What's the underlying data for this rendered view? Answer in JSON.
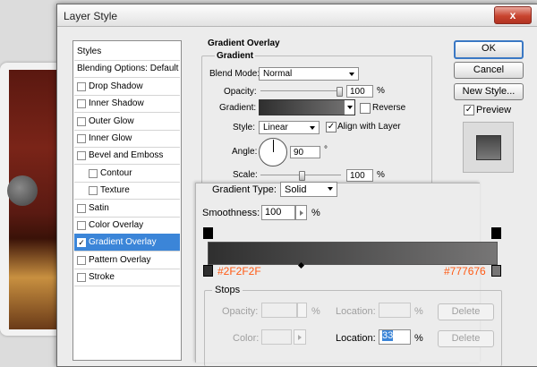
{
  "dialog": {
    "title": "Layer Style",
    "close": "x"
  },
  "styles_list": [
    {
      "label": "Styles",
      "checkbox": false,
      "selected": false,
      "indent": 0
    },
    {
      "label": "Blending Options: Default",
      "checkbox": false,
      "selected": false,
      "indent": 0
    },
    {
      "label": "Drop Shadow",
      "checkbox": true,
      "checked": false,
      "selected": false,
      "indent": 0
    },
    {
      "label": "Inner Shadow",
      "checkbox": true,
      "checked": false,
      "selected": false,
      "indent": 0
    },
    {
      "label": "Outer Glow",
      "checkbox": true,
      "checked": false,
      "selected": false,
      "indent": 0
    },
    {
      "label": "Inner Glow",
      "checkbox": true,
      "checked": false,
      "selected": false,
      "indent": 0
    },
    {
      "label": "Bevel and Emboss",
      "checkbox": true,
      "checked": false,
      "selected": false,
      "indent": 0
    },
    {
      "label": "Contour",
      "checkbox": true,
      "checked": false,
      "selected": false,
      "indent": 1
    },
    {
      "label": "Texture",
      "checkbox": true,
      "checked": false,
      "selected": false,
      "indent": 1
    },
    {
      "label": "Satin",
      "checkbox": true,
      "checked": false,
      "selected": false,
      "indent": 0
    },
    {
      "label": "Color Overlay",
      "checkbox": true,
      "checked": false,
      "selected": false,
      "indent": 0
    },
    {
      "label": "Gradient Overlay",
      "checkbox": true,
      "checked": true,
      "selected": true,
      "indent": 0
    },
    {
      "label": "Pattern Overlay",
      "checkbox": true,
      "checked": false,
      "selected": false,
      "indent": 0
    },
    {
      "label": "Stroke",
      "checkbox": true,
      "checked": false,
      "selected": false,
      "indent": 0
    }
  ],
  "gradient_overlay": {
    "section_title": "Gradient Overlay",
    "group_title": "Gradient",
    "blend_mode_label": "Blend Mode:",
    "blend_mode_value": "Normal",
    "opacity_label": "Opacity:",
    "opacity_value": "100",
    "opacity_pct": 1.0,
    "percent": "%",
    "gradient_label": "Gradient:",
    "reverse_label": "Reverse",
    "reverse_checked": false,
    "style_label": "Style:",
    "style_value": "Linear",
    "align_label": "Align with Layer",
    "align_checked": true,
    "angle_label": "Angle:",
    "angle_value": "90",
    "degree": "°",
    "scale_label": "Scale:",
    "scale_value": "100",
    "scale_pct": 0.5
  },
  "buttons": {
    "ok": "OK",
    "cancel": "Cancel",
    "new_style": "New Style...",
    "preview_label": "Preview",
    "preview_checked": true
  },
  "gradient_editor": {
    "gradient_type_label": "Gradient Type:",
    "gradient_type_value": "Solid",
    "smoothness_label": "Smoothness:",
    "smoothness_value": "100",
    "percent": "%",
    "left_color": "#2f2f2f",
    "right_color": "#777676",
    "left_color_label": "#2F2F2F",
    "right_color_label": "#777676",
    "stops_title": "Stops",
    "opacity_label": "Opacity:",
    "location_label": "Location:",
    "delete_label": "Delete",
    "color_label": "Color:",
    "location_value": "33",
    "hex_color": "#ff5a14"
  }
}
